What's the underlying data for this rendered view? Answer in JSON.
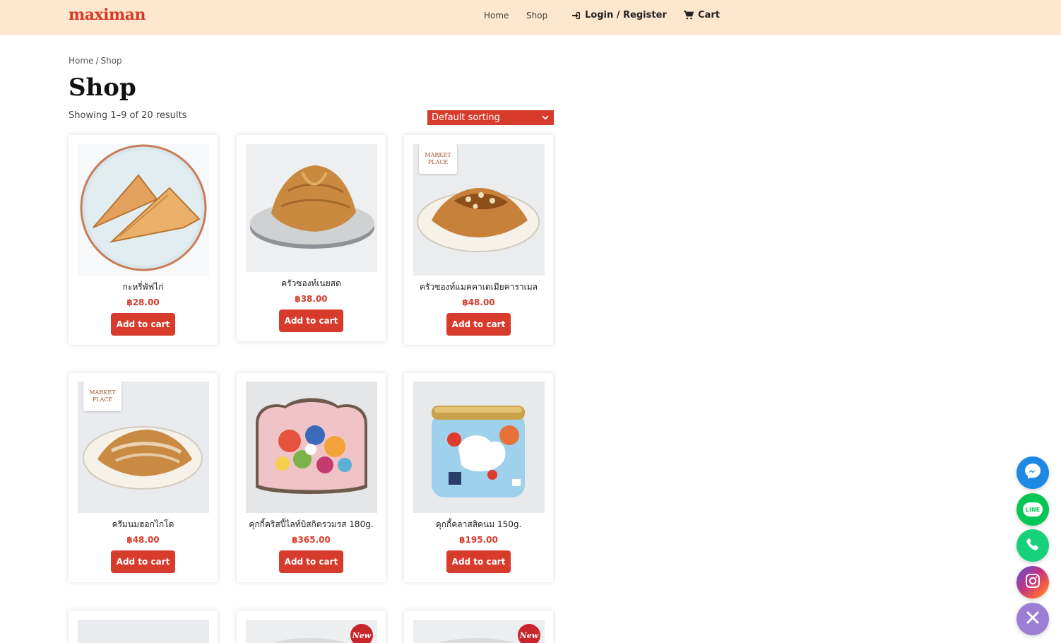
{
  "header": {
    "logo": "maximan",
    "nav": {
      "home": "Home",
      "shop": "Shop",
      "login": "Login / Register",
      "cart": "Cart"
    }
  },
  "breadcrumb": {
    "home": "Home",
    "separator": "/",
    "current": "Shop"
  },
  "page": {
    "title": "Shop",
    "result_count": "Showing 1–9 of 20 results",
    "sort_selected": "Default sorting"
  },
  "products": [
    {
      "name": "กะหรี่พัฟไก่",
      "price": "฿28.00",
      "button": "Add to cart"
    },
    {
      "name": "ครัวซองท์เนยสด",
      "price": "฿38.00",
      "button": "Add to cart"
    },
    {
      "name": "ครัวซองท์แมคคาเดเมียคาราเมล",
      "price": "฿48.00",
      "button": "Add to cart"
    },
    {
      "name": "ครีมนมฮอกไกโด",
      "price": "฿48.00",
      "button": "Add to cart"
    },
    {
      "name": "คุกกี้คริสปี้ไลท์บิสกิตรวมรส 180g.",
      "price": "฿365.00",
      "button": "Add to cart"
    },
    {
      "name": "คุกกี้คลาสสิคนม 150g.",
      "price": "฿195.00",
      "button": "Add to cart"
    }
  ],
  "badges": {
    "marketplace_top": "MARKET",
    "marketplace_bottom": "PLACE",
    "new": "New"
  },
  "floating": {
    "line_label": "LINE"
  },
  "colors": {
    "accent": "#d63b2b",
    "header_bg": "#fde8cf",
    "messenger": "#1e88e5",
    "line": "#06c755",
    "phone": "#17d17a",
    "close": "#9b7fd4"
  }
}
